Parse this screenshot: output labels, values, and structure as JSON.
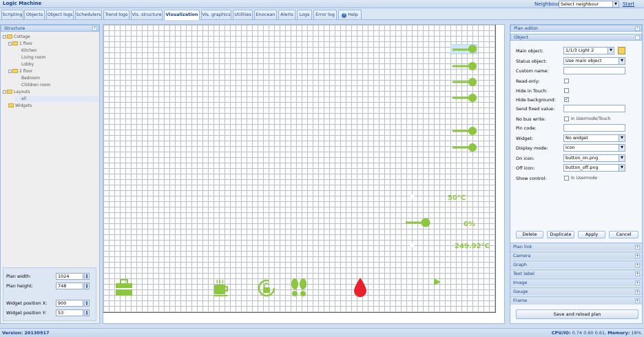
{
  "app": {
    "title": "Logic Machine",
    "neighbours_label": "Neighbours:",
    "neighbour_select": "Select neighbour",
    "start_page": "Start page"
  },
  "tabs": [
    "Scripting",
    "Objects",
    "Object logs",
    "Schedulers",
    "Trend logs",
    "Vis. structure",
    "Visualization",
    "Vis. graphics",
    "Utilities",
    "Enocean",
    "Alerts",
    "Logs",
    "Error log",
    "Help"
  ],
  "structure": {
    "title": "Structure",
    "tree": [
      "Cottage",
      "1 floor",
      "Kitchen",
      "Living room",
      "Lobby",
      "2 floor",
      "Bedroom",
      "Children room",
      "Layouts",
      "all",
      "Widgets"
    ],
    "plan_width_label": "Plan width:",
    "plan_width": "1024",
    "plan_height_label": "Plan height:",
    "plan_height": "748",
    "widget_x_label": "Widget position X:",
    "widget_x": "900",
    "widget_y_label": "Widget position Y:",
    "widget_y": "53"
  },
  "canvas": {
    "temp1": "50°C",
    "percent": "0%",
    "temp2": "249.92°C"
  },
  "plan_editor": {
    "title": "Plan editor",
    "section": "Object",
    "main_object_label": "Main object:",
    "main_object": "1/1/3 Light 2",
    "status_object_label": "Status object:",
    "status_object": "Use main object",
    "custom_name_label": "Custom name:",
    "read_only_label": "Read-only:",
    "hide_touch_label": "Hide in Touch:",
    "hide_bg_label": "Hide background:",
    "send_fixed_label": "Send fixed value:",
    "no_bus_label": "No bus write:",
    "no_bus_cb": "In Usermode/Touch",
    "pin_label": "Pin code:",
    "widget_label": "Widget:",
    "widget": "No widget",
    "display_label": "Display mode:",
    "display": "Icon",
    "on_icon_label": "On icon:",
    "on_icon": "button_on.png",
    "off_icon_label": "Off icon:",
    "off_icon": "button_off.png",
    "show_control_label": "Show control:",
    "show_control_cb": "In Usermode",
    "buttons": {
      "delete": "Delete",
      "duplicate": "Duplicate",
      "apply": "Apply",
      "cancel": "Cancel"
    },
    "sections": [
      "Plan link",
      "Camera",
      "Graph",
      "Text label",
      "Image",
      "Gauge",
      "Frame"
    ],
    "save": "Save and reload plan"
  },
  "status": {
    "version": "Version: 20130917",
    "cpu_label": "CPU/IO:",
    "cpu": "0.74 0.60 0.61,",
    "mem_label": "Memory:",
    "mem": "18%"
  },
  "colors": {
    "accent": "#8dc63f",
    "drop": "#e8212b",
    "header": "#15428b"
  }
}
